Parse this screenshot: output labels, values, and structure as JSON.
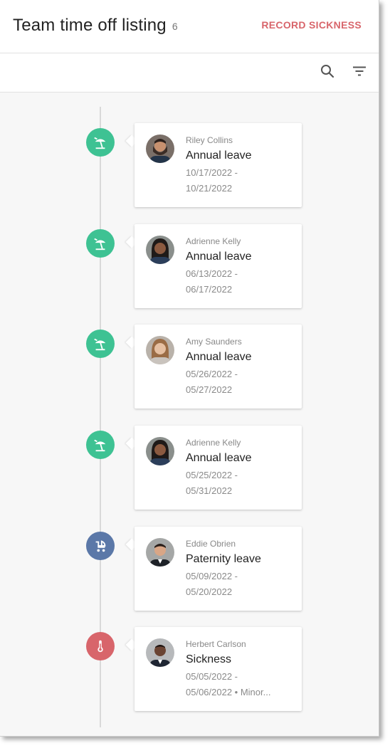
{
  "header": {
    "title": "Team time off listing",
    "count": "6",
    "record_label": "RECORD SICKNESS"
  },
  "toolbar": {
    "search_icon": "search-icon",
    "filter_icon": "filter-icon"
  },
  "colors": {
    "annual": "#3ec293",
    "paternity": "#5b78a8",
    "sickness": "#d8656b",
    "accent_text": "#d8656b"
  },
  "entries": [
    {
      "name": "Riley Collins",
      "type": "Annual leave",
      "date_start": "10/17/2022 -",
      "date_end": "10/21/2022",
      "icon": "beach-umbrella-icon"
    },
    {
      "name": "Adrienne Kelly",
      "type": "Annual leave",
      "date_start": "06/13/2022 -",
      "date_end": "06/17/2022",
      "icon": "beach-umbrella-icon"
    },
    {
      "name": "Amy Saunders",
      "type": "Annual leave",
      "date_start": "05/26/2022 -",
      "date_end": "05/27/2022",
      "icon": "beach-umbrella-icon"
    },
    {
      "name": "Adrienne Kelly",
      "type": "Annual leave",
      "date_start": "05/25/2022 -",
      "date_end": "05/31/2022",
      "icon": "beach-umbrella-icon"
    },
    {
      "name": "Eddie Obrien",
      "type": "Paternity leave",
      "date_start": "05/09/2022 -",
      "date_end": "05/20/2022",
      "icon": "stroller-icon"
    },
    {
      "name": "Herbert Carlson",
      "type": "Sickness",
      "date_start": "05/05/2022 -",
      "date_end": "05/06/2022 • Minor...",
      "icon": "thermometer-icon"
    }
  ]
}
